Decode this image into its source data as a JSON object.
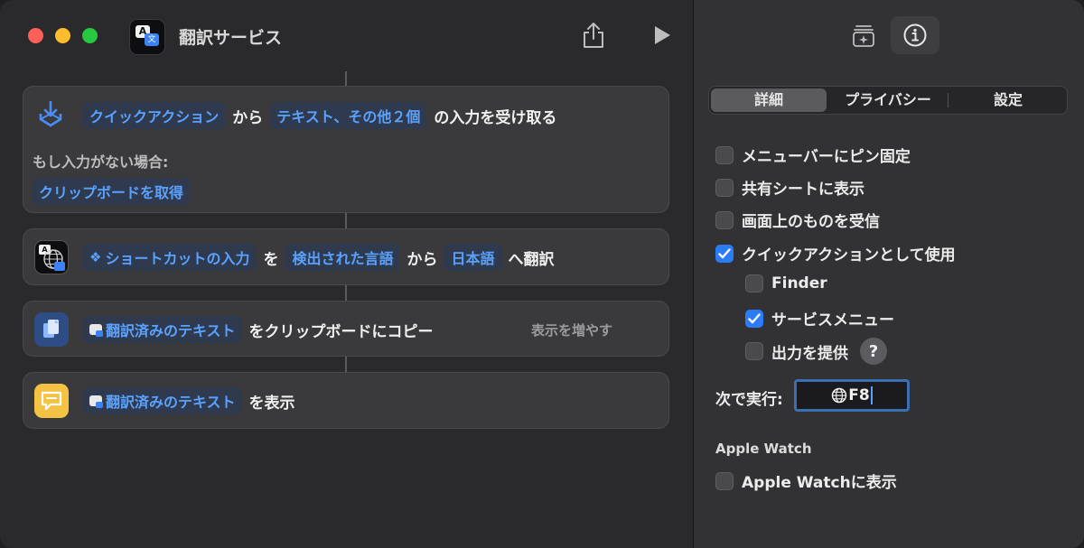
{
  "window": {
    "title": "翻訳サービス"
  },
  "actions": {
    "receive": {
      "token_source": "クイックアクション",
      "from": "から",
      "token_types": "テキスト、その他２個",
      "tail": "の入力を受け取る",
      "no_input_label": "もし入力がない場合:",
      "token_fallback": "クリップボードを取得"
    },
    "translate": {
      "token_input": "ショートカットの入力",
      "wo": "を",
      "token_detected": "検出された言語",
      "from": "から",
      "token_target": "日本語",
      "tail": "へ翻訳"
    },
    "copy": {
      "token_text": "翻訳済みのテキスト",
      "tail": "をクリップボードにコピー",
      "more": "表示を増やす"
    },
    "show": {
      "token_text": "翻訳済みのテキスト",
      "tail": "を表示"
    }
  },
  "inspector": {
    "tabs": [
      "詳細",
      "プライバシー",
      "設定"
    ],
    "selected_tab": "詳細",
    "options": {
      "pin_menubar": {
        "label": "メニューバーにピン固定",
        "checked": false
      },
      "share_sheet": {
        "label": "共有シートに表示",
        "checked": false
      },
      "screen_receive": {
        "label": "画面上のものを受信",
        "checked": false
      },
      "quick_action": {
        "label": "クイックアクションとして使用",
        "checked": true
      },
      "finder": {
        "label": "Finder",
        "checked": false
      },
      "services_menu": {
        "label": "サービスメニュー",
        "checked": true
      },
      "provide_output": {
        "label": "出力を提供",
        "checked": false
      }
    },
    "help": "?",
    "run_with_label": "次で実行:",
    "shortcut_value": "F8",
    "apple_watch_section": "Apple Watch",
    "apple_watch_option": {
      "label": "Apple Watchに表示",
      "checked": false
    }
  },
  "colors": {
    "accent": "#2b7cf6",
    "token_text": "#5aa2ff",
    "close": "#fe5f57",
    "minimize": "#febc2e",
    "zoom": "#28c840"
  }
}
